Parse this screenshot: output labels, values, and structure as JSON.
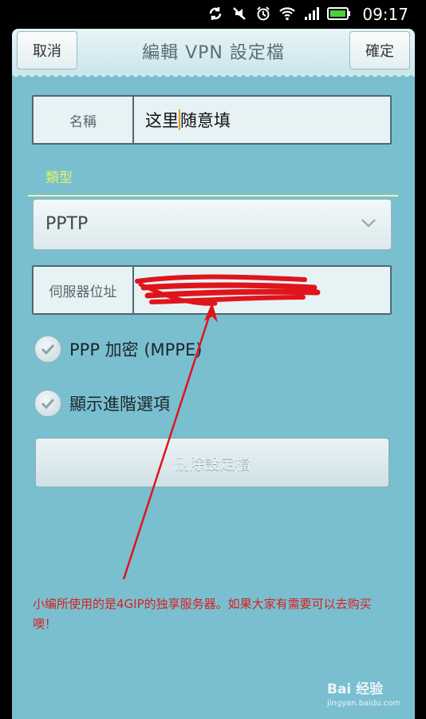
{
  "status_bar": {
    "time": "09:17",
    "icons": [
      "sync-icon",
      "mute-icon",
      "alarm-icon",
      "wifi-icon",
      "signal-icon",
      "battery-icon"
    ]
  },
  "titlebar": {
    "cancel_label": "取消",
    "title": "編輯 VPN 設定檔",
    "confirm_label": "確定"
  },
  "form": {
    "name": {
      "label": "名稱",
      "value_before_caret": "这里",
      "value_after_caret": "随意填"
    },
    "type_section_label": "類型",
    "type_select": {
      "selected": "PPTP"
    },
    "server": {
      "label": "伺服器位址",
      "value": ""
    },
    "ppp_encryption": {
      "label": "PPP 加密 (MPPE)",
      "checked": true
    },
    "show_advanced": {
      "label": "顯示進階選項",
      "checked": true
    },
    "delete_button_label": "刪除設定檔"
  },
  "annotation": {
    "text": "小编所使用的是4GIP的独享服务器。如果大家有需要可以去购买噢！",
    "color": "#d8201f"
  },
  "watermark": {
    "brand": "Bai 经验",
    "url": "jingyan.baidu.com"
  },
  "colors": {
    "app_background": "#79bfd0",
    "section_label": "#e6f06a",
    "annotation_red": "#d8201f"
  }
}
